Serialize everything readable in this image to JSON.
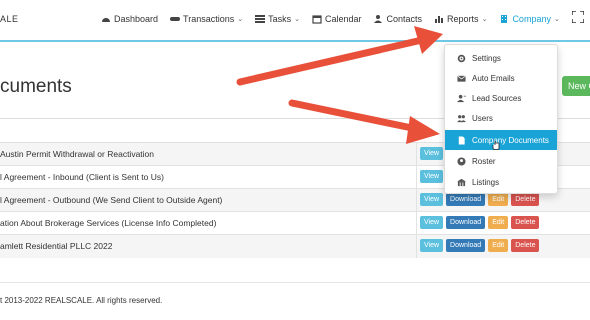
{
  "brand": "ALE",
  "nav": {
    "items": [
      {
        "label": "Dashboard",
        "icon": "dashboard-icon"
      },
      {
        "label": "Transactions",
        "icon": "handshake-icon",
        "caret": true
      },
      {
        "label": "Tasks",
        "icon": "tasks-icon",
        "caret": true
      },
      {
        "label": "Calendar",
        "icon": "calendar-icon"
      },
      {
        "label": "Contacts",
        "icon": "contacts-icon"
      },
      {
        "label": "Reports",
        "icon": "reports-icon",
        "caret": true
      },
      {
        "label": "Company",
        "icon": "company-icon",
        "caret": true,
        "active": true
      }
    ],
    "caret_glyph": "⌄"
  },
  "page": {
    "title": "cuments",
    "new_button": "New C"
  },
  "rows": [
    {
      "name": "Austin Permit Withdrawal or Reactivation",
      "actions": [
        "View"
      ]
    },
    {
      "name": "l Agreement - Inbound (Client is Sent to Us)",
      "actions": [
        "View"
      ]
    },
    {
      "name": "l Agreement - Outbound (We Send Client to Outside Agent)",
      "actions": [
        "View",
        "Download",
        "Edit",
        "Delete"
      ]
    },
    {
      "name": "ation About Brokerage Services (License Info Completed)",
      "actions": [
        "View",
        "Download",
        "Edit",
        "Delete"
      ]
    },
    {
      "name": "amlett Residential PLLC 2022",
      "actions": [
        "View",
        "Download",
        "Edit",
        "Delete"
      ]
    }
  ],
  "footer": "t 2013-2022 REALSCALE. All rights reserved.",
  "dropdown": {
    "items": [
      {
        "label": "Settings",
        "icon": "gear-icon"
      },
      {
        "label": "Auto Emails",
        "icon": "envelope-icon"
      },
      {
        "label": "Lead Sources",
        "icon": "user-plus-icon"
      },
      {
        "label": "Users",
        "icon": "users-icon"
      },
      {
        "label": "Company Documents",
        "icon": "document-icon",
        "active": true
      },
      {
        "label": "Roster",
        "icon": "user-circle-icon"
      },
      {
        "label": "Listings",
        "icon": "building-icon"
      }
    ]
  },
  "colors": {
    "accent": "#1aa3d6",
    "arrow": "#e8503a",
    "success": "#5cb85c"
  }
}
